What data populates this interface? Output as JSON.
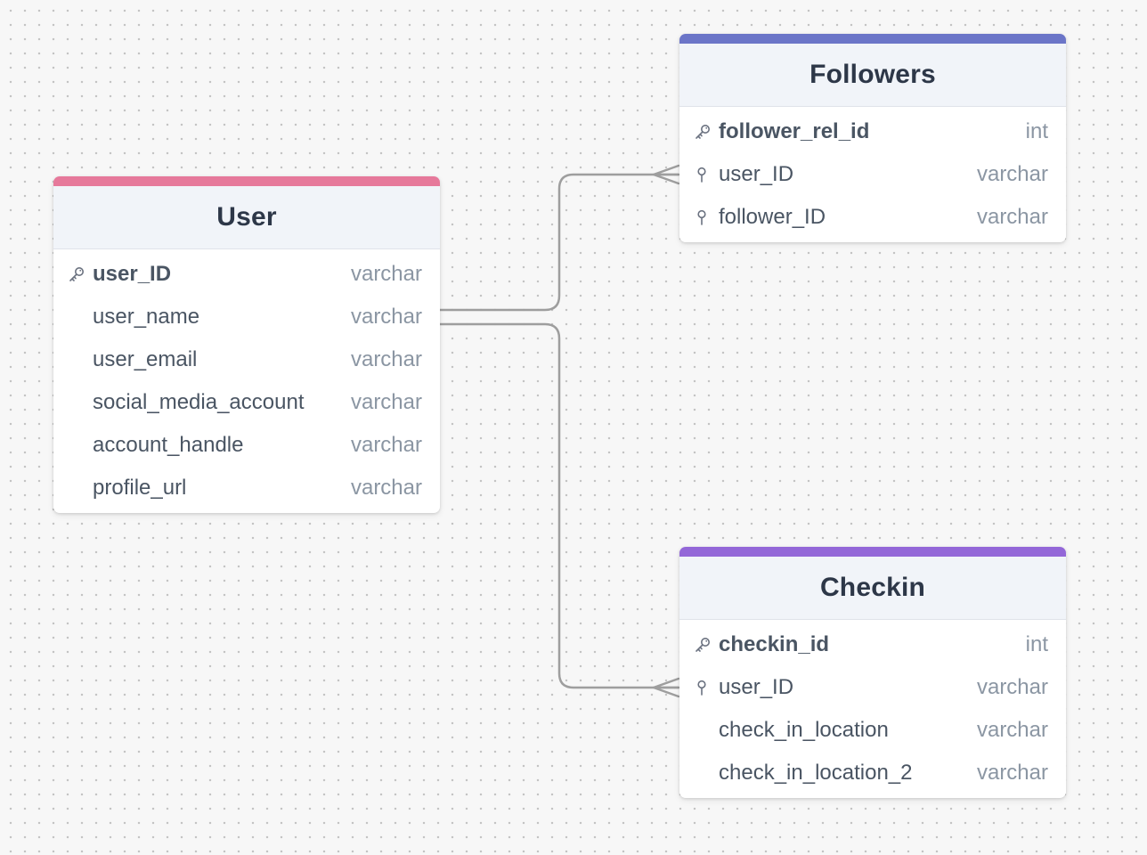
{
  "colors": {
    "user_accent": "#e6799b",
    "followers_accent": "#6b75c8",
    "checkin_accent": "#9367d8",
    "connector": "#9e9e9e"
  },
  "tables": {
    "user": {
      "title": "User",
      "columns": [
        {
          "name": "user_ID",
          "type": "varchar",
          "icon": "key-icon"
        },
        {
          "name": "user_name",
          "type": "varchar",
          "icon": ""
        },
        {
          "name": "user_email",
          "type": "varchar",
          "icon": ""
        },
        {
          "name": "social_media_account",
          "type": "varchar",
          "icon": ""
        },
        {
          "name": "account_handle",
          "type": "varchar",
          "icon": ""
        },
        {
          "name": "profile_url",
          "type": "varchar",
          "icon": ""
        }
      ]
    },
    "followers": {
      "title": "Followers",
      "columns": [
        {
          "name": "follower_rel_id",
          "type": "int",
          "icon": "key-icon"
        },
        {
          "name": "user_ID",
          "type": "varchar",
          "icon": "foreign-key-icon"
        },
        {
          "name": "follower_ID",
          "type": "varchar",
          "icon": "foreign-key-icon"
        }
      ]
    },
    "checkin": {
      "title": "Checkin",
      "columns": [
        {
          "name": "checkin_id",
          "type": "int",
          "icon": "key-icon"
        },
        {
          "name": "user_ID",
          "type": "varchar",
          "icon": "foreign-key-icon"
        },
        {
          "name": "check_in_location",
          "type": "varchar",
          "icon": ""
        },
        {
          "name": "check_in_location_2",
          "type": "varchar",
          "icon": ""
        }
      ]
    }
  },
  "relationships": [
    {
      "from": "User.user_ID",
      "to": "Followers.user_ID",
      "from_cardinality": "one",
      "to_cardinality": "many"
    },
    {
      "from": "User.user_ID",
      "to": "Checkin.user_ID",
      "from_cardinality": "one",
      "to_cardinality": "many"
    }
  ]
}
